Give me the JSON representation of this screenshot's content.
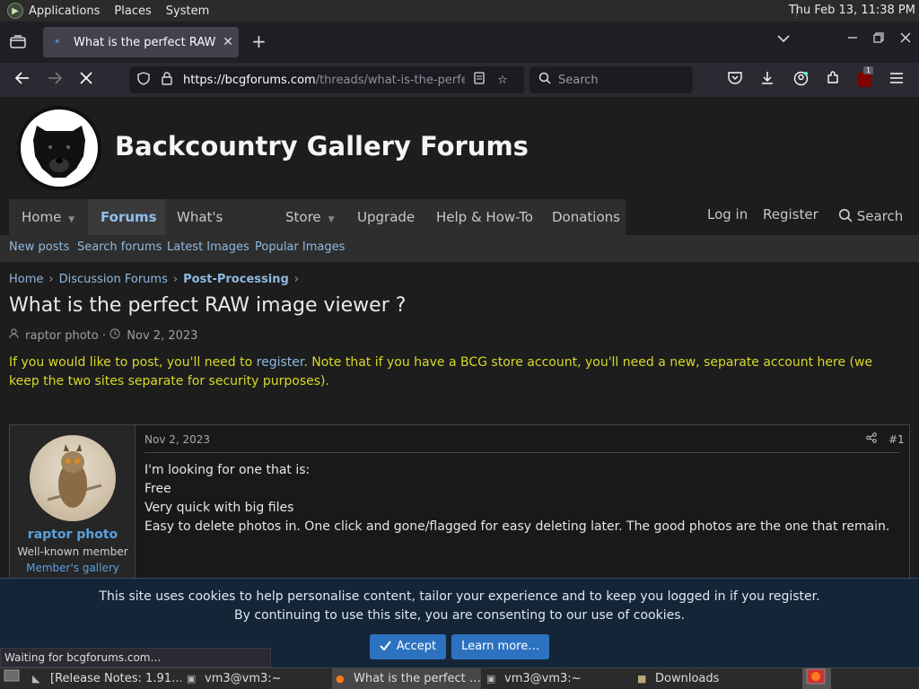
{
  "system_panel": {
    "menus": [
      "Applications",
      "Places",
      "System"
    ],
    "clock": "Thu Feb 13, 11:38 PM"
  },
  "browser": {
    "tab": {
      "title": "What is the perfect RAW im"
    },
    "url": {
      "host": "https://bcgforums.com",
      "path": "/threads/what-is-the-perfe"
    },
    "search_placeholder": "Search",
    "extension_badge": "1",
    "status_text": "Waiting for bcgforums.com…"
  },
  "site": {
    "title": "Backcountry Gallery Forums",
    "nav": [
      {
        "label": "Home"
      },
      {
        "label": "Forums"
      },
      {
        "label": "What's new"
      },
      {
        "label": "Store"
      },
      {
        "label": "Upgrade"
      },
      {
        "label": "Help & How-To"
      },
      {
        "label": "Donations"
      }
    ],
    "nav_right": {
      "login": "Log in",
      "register": "Register",
      "search": "Search"
    },
    "subnav": [
      "New posts",
      "Search forums",
      "Latest Images",
      "Popular Images"
    ]
  },
  "breadcrumb": [
    "Home",
    "Discussion Forums",
    "Post-Processing"
  ],
  "thread": {
    "title": "What is the perfect RAW image viewer ?",
    "author": "raptor photo",
    "date": "Nov 2, 2023"
  },
  "notice": {
    "before_link": "If you would like to post, you'll need to ",
    "link": "register",
    "after_link": ". Note that if you have a BCG store account, you'll need a new, separate account here (we keep the two sites separate for security purposes)."
  },
  "post": {
    "username": "raptor photo",
    "user_title": "Well-known member",
    "user_link": "Member's gallery",
    "date": "Nov 2, 2023",
    "number": "#1",
    "lines": [
      "I'm looking for one that is:",
      "Free",
      "Very quick with big files",
      "Easy to delete photos in. One click and gone/flagged for easy deleting later. The good photos are the one that remain."
    ]
  },
  "cookie_banner": {
    "line1": "This site uses cookies to help personalise content, tailor your experience and to keep you logged in if you register.",
    "line2": "By continuing to use this site, you are consenting to our use of cookies.",
    "accept": "Accept",
    "learn_more": "Learn more…"
  },
  "taskbar": {
    "items": [
      "[Release Notes: 1.91…",
      "vm3@vm3:~",
      "What is the perfect …",
      "vm3@vm3:~",
      "Downloads"
    ]
  }
}
